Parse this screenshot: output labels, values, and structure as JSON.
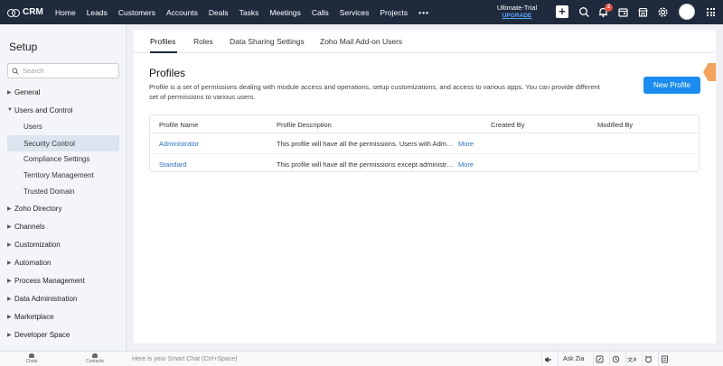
{
  "app": {
    "logo_text": "CRM"
  },
  "topnav": {
    "items": [
      "Home",
      "Leads",
      "Customers",
      "Accounts",
      "Deals",
      "Tasks",
      "Meetings",
      "Calls",
      "Services",
      "Projects"
    ],
    "more": "•••",
    "trial_label": "Ultimate-Trial",
    "upgrade_label": "UPGRADE",
    "notification_count": "2",
    "icons": [
      "plus-icon",
      "search-icon",
      "bell-icon",
      "calendar-icon",
      "marketplace-icon",
      "gear-icon",
      "avatar",
      "apps-grid-icon"
    ]
  },
  "sidebar": {
    "title": "Setup",
    "search_placeholder": "Search",
    "sections": [
      {
        "label": "General",
        "expanded": false
      },
      {
        "label": "Users and Control",
        "expanded": true,
        "children": [
          "Users",
          "Security Control",
          "Compliance Settings",
          "Territory Management",
          "Trusted Domain"
        ],
        "active_child": "Security Control"
      },
      {
        "label": "Zoho Directory",
        "expanded": false
      },
      {
        "label": "Channels",
        "expanded": false
      },
      {
        "label": "Customization",
        "expanded": false
      },
      {
        "label": "Automation",
        "expanded": false
      },
      {
        "label": "Process Management",
        "expanded": false
      },
      {
        "label": "Data Administration",
        "expanded": false
      },
      {
        "label": "Marketplace",
        "expanded": false
      },
      {
        "label": "Developer Space",
        "expanded": false
      }
    ]
  },
  "main": {
    "tabs": [
      "Profiles",
      "Roles",
      "Data Sharing Settings",
      "Zoho Mail Add-on Users"
    ],
    "active_tab": "Profiles",
    "title": "Profiles",
    "description": "Profile is a set of permissions dealing with module access and operations, setup customizations, and access to various apps. You can provide different set of permissions to various users.",
    "new_button": "New Profile",
    "table": {
      "columns": [
        "Profile Name",
        "Profile Description",
        "Created By",
        "Modified By"
      ],
      "rows": [
        {
          "name": "Administrator",
          "description": "This profile will have all the permissions. Users with Administrator profile can view and manage all the data within the organization account by default.",
          "created_by": "",
          "modified_by": "",
          "more": "More"
        },
        {
          "name": "Standard",
          "description": "This profile will have all the permissions except administrative privileges.",
          "created_by": "",
          "modified_by": "",
          "more": "More"
        }
      ]
    }
  },
  "bottombar": {
    "left": [
      "Chats",
      "Contacts"
    ],
    "smart_chat_placeholder": "Here is your Smart Chat (Ctrl+Space)",
    "ask_zia": "Ask Zia"
  },
  "colors": {
    "topbar": "#1f2b3d",
    "primary_button": "#1a8cf0",
    "link": "#2a72c8",
    "badge": "#e74c3c",
    "active_row": "#dce4ef"
  }
}
